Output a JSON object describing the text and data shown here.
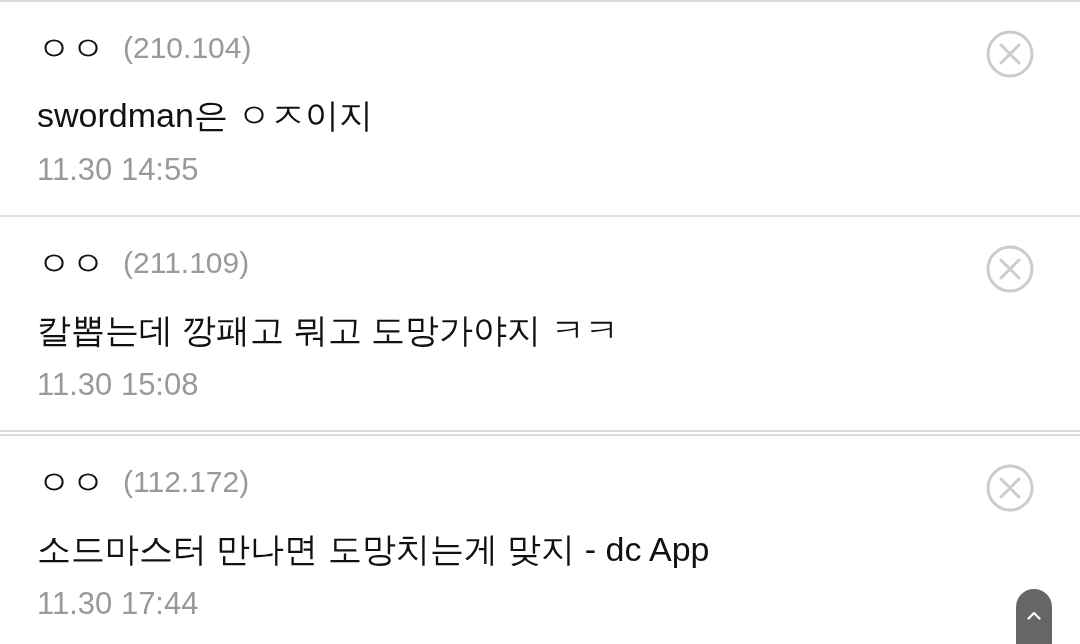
{
  "comments": [
    {
      "double_divider": false,
      "nickname": "ㅇㅇ",
      "ip": "(210.104)",
      "text": "swordman은 ㅇㅈ이지",
      "date": "11.30 14:55"
    },
    {
      "double_divider": false,
      "nickname": "ㅇㅇ",
      "ip": "(211.109)",
      "text": "칼뽑는데 깡패고 뭐고 도망가야지 ㅋㅋ",
      "date": "11.30 15:08"
    },
    {
      "double_divider": true,
      "nickname": "ㅇㅇ",
      "ip": "(112.172)",
      "text": "소드마스터 만나면 도망치는게 맞지 - dc App",
      "date": "11.30 17:44"
    }
  ]
}
